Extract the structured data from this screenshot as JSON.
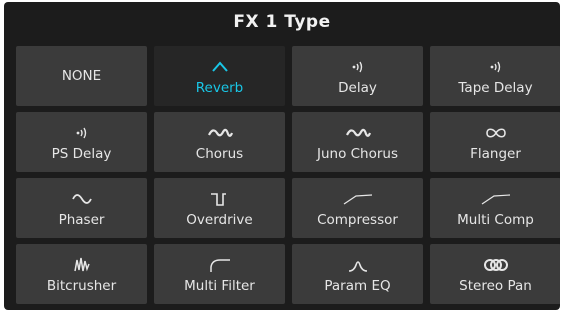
{
  "header": {
    "title": "FX 1 Type"
  },
  "accent_color": "#19c6e6",
  "grid": {
    "items": [
      {
        "label": "NONE",
        "icon": "none",
        "selected": false
      },
      {
        "label": "Reverb",
        "icon": "caret-up-icon",
        "selected": true
      },
      {
        "label": "Delay",
        "icon": "radiating-dot-icon",
        "selected": false
      },
      {
        "label": "Tape Delay",
        "icon": "radiating-dot-icon",
        "selected": false
      },
      {
        "label": "PS Delay",
        "icon": "radiating-dot-icon",
        "selected": false
      },
      {
        "label": "Chorus",
        "icon": "wave-squiggle-icon",
        "selected": false
      },
      {
        "label": "Juno Chorus",
        "icon": "wave-squiggle-icon",
        "selected": false
      },
      {
        "label": "Flanger",
        "icon": "infinity-icon",
        "selected": false
      },
      {
        "label": "Phaser",
        "icon": "sine-wave-icon",
        "selected": false
      },
      {
        "label": "Overdrive",
        "icon": "square-pulse-icon",
        "selected": false
      },
      {
        "label": "Compressor",
        "icon": "compressor-curve-icon",
        "selected": false
      },
      {
        "label": "Multi Comp",
        "icon": "compressor-curve-icon",
        "selected": false
      },
      {
        "label": "Bitcrusher",
        "icon": "spiky-wave-icon",
        "selected": false
      },
      {
        "label": "Multi Filter",
        "icon": "filter-curve-icon",
        "selected": false
      },
      {
        "label": "Param EQ",
        "icon": "peak-curve-icon",
        "selected": false
      },
      {
        "label": "Stereo Pan",
        "icon": "triple-ring-icon",
        "selected": false
      }
    ]
  }
}
